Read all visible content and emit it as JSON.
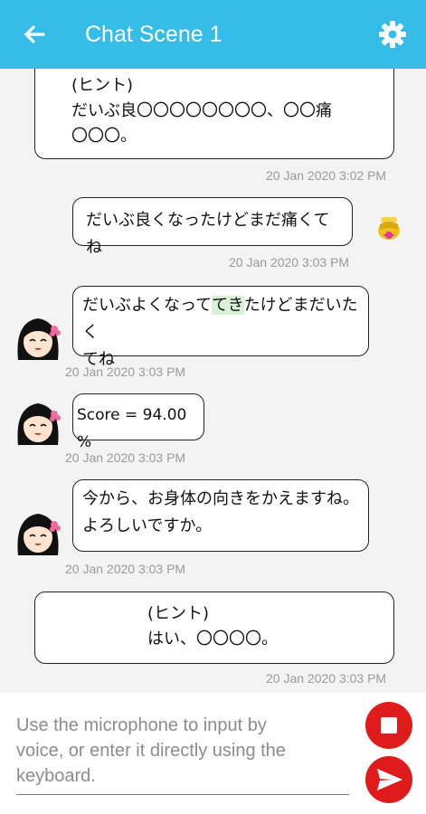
{
  "appbar": {
    "title": "Chat Scene 1",
    "back_icon": "arrow-left-icon",
    "settings_icon": "gear-icon",
    "background": "#35bde8"
  },
  "messages": {
    "hint1": {
      "label": "(ヒント)",
      "line1": "だいぶ良〇〇〇〇〇〇〇〇、〇〇痛",
      "line2": "〇〇〇。",
      "time": "20 Jan 2020 3:02 PM"
    },
    "user1": {
      "text": "だいぶ良くなったけどまだ痛くてね",
      "time": "20 Jan 2020 3:03 PM",
      "avatar_icon": "honey-pot-icon"
    },
    "bot1": {
      "part1": "だいぶよくなって",
      "highlight": "てき",
      "part2": "たけどまだいたく",
      "line2": "てね",
      "time": "20 Jan 2020 3:03 PM"
    },
    "bot2": {
      "text": "Score = 94.00 %",
      "time": "20 Jan 2020 3:03 PM"
    },
    "bot3": {
      "line1": "今から、お身体の向きをかえますね。",
      "line2": "よろしいですか。",
      "time": "20 Jan 2020 3:03 PM"
    },
    "hint2": {
      "label": "(ヒント)",
      "line1": "はい、〇〇〇〇。",
      "time": "20 Jan 2020 3:03 PM"
    }
  },
  "input": {
    "placeholder_line1": "Use the microphone to input by",
    "placeholder_line2": "voice, or enter it directly using the",
    "placeholder_line3": "keyboard.",
    "stop_icon": "stop-icon",
    "send_icon": "send-icon",
    "button_color": "#e01b1b"
  }
}
